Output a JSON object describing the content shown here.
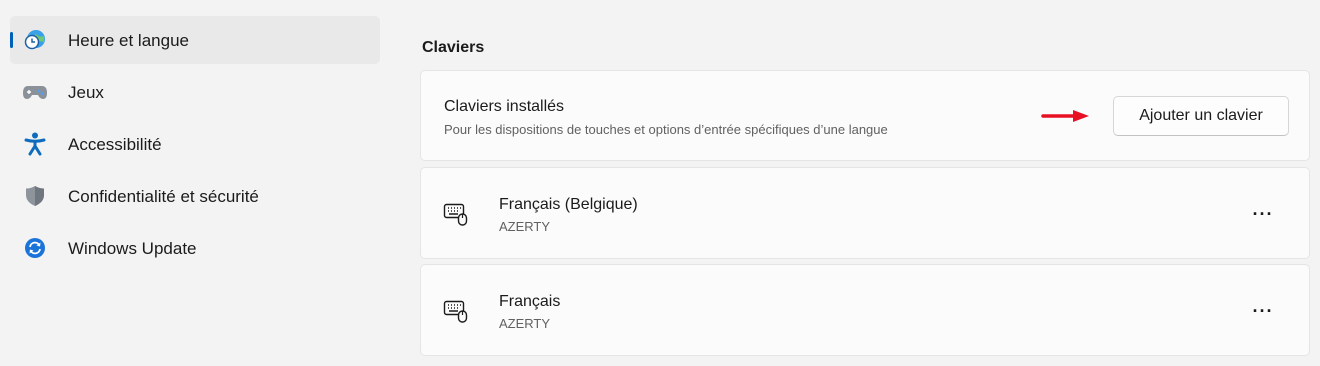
{
  "sidebar": {
    "items": [
      {
        "label": "Heure et langue",
        "icon": "globe-clock-icon",
        "selected": true
      },
      {
        "label": "Jeux",
        "icon": "gamepad-icon",
        "selected": false
      },
      {
        "label": "Accessibilité",
        "icon": "accessibility-icon",
        "selected": false
      },
      {
        "label": "Confidentialité et sécurité",
        "icon": "shield-icon",
        "selected": false
      },
      {
        "label": "Windows Update",
        "icon": "windows-update-icon",
        "selected": false
      }
    ]
  },
  "main": {
    "section_title": "Claviers",
    "installed": {
      "title": "Claviers installés",
      "subtitle": "Pour les dispositions de touches et options d’entrée spécifiques d’une langue",
      "add_button": "Ajouter un clavier"
    },
    "keyboards": [
      {
        "name": "Français (Belgique)",
        "layout": "AZERTY",
        "more": "···"
      },
      {
        "name": "Français",
        "layout": "AZERTY",
        "more": "···"
      }
    ]
  },
  "colors": {
    "accent": "#005fb8",
    "arrow": "#e81123",
    "background": "#f3f3f3",
    "card": "#fbfbfb"
  }
}
